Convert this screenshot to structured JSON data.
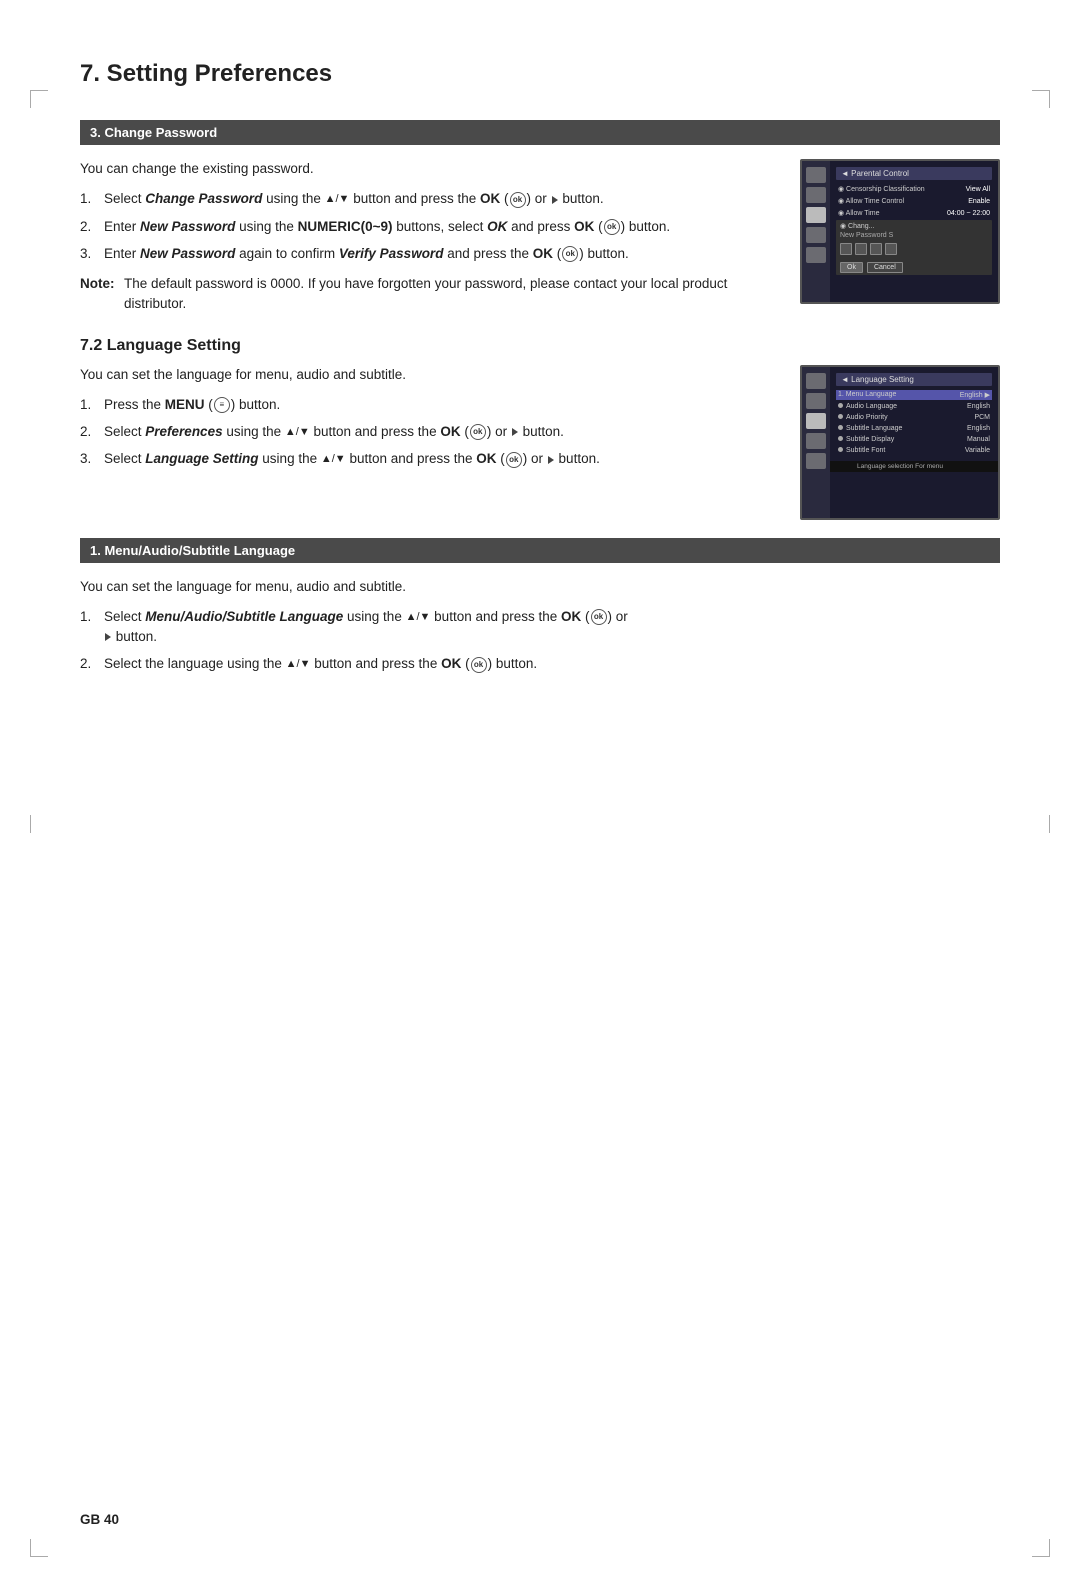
{
  "page": {
    "title": "7. Setting Preferences",
    "footer": "GB 40"
  },
  "section_change_password": {
    "header": "3. Change Password",
    "description": "You can change the existing password.",
    "steps": [
      {
        "num": "1.",
        "text_parts": [
          {
            "type": "text",
            "content": "Select "
          },
          {
            "type": "bold-italic",
            "content": "Change Password"
          },
          {
            "type": "text",
            "content": " using the ▲/▼ button and press the "
          },
          {
            "type": "bold",
            "content": "OK"
          },
          {
            "type": "text",
            "content": " ("
          },
          {
            "type": "ok-symbol",
            "content": "ok"
          },
          {
            "type": "text",
            "content": ") or "
          },
          {
            "type": "arrow",
            "content": "▶"
          },
          {
            "type": "text",
            "content": " button."
          }
        ]
      },
      {
        "num": "2.",
        "text_parts": [
          {
            "type": "text",
            "content": "Enter "
          },
          {
            "type": "bold-italic",
            "content": "New Password"
          },
          {
            "type": "text",
            "content": " using the "
          },
          {
            "type": "bold",
            "content": "NUMERIC(0~9)"
          },
          {
            "type": "text",
            "content": " buttons, select "
          },
          {
            "type": "bold-italic",
            "content": "OK"
          },
          {
            "type": "text",
            "content": " and press "
          },
          {
            "type": "bold",
            "content": "OK"
          },
          {
            "type": "text",
            "content": " ("
          },
          {
            "type": "ok-symbol",
            "content": "ok"
          },
          {
            "type": "text",
            "content": ") button."
          }
        ]
      },
      {
        "num": "3.",
        "text_parts": [
          {
            "type": "text",
            "content": "Enter "
          },
          {
            "type": "bold-italic",
            "content": "New Password"
          },
          {
            "type": "text",
            "content": " again to confirm "
          },
          {
            "type": "bold-italic",
            "content": "Verify Password"
          },
          {
            "type": "text",
            "content": " and press the "
          },
          {
            "type": "bold",
            "content": "OK"
          },
          {
            "type": "text",
            "content": " ("
          },
          {
            "type": "ok-symbol",
            "content": "ok"
          },
          {
            "type": "text",
            "content": ") button."
          }
        ]
      }
    ],
    "note_label": "Note:",
    "note_text": "The default password is 0000. If you have forgotten your password, please contact your local product distributor.",
    "screenshot": {
      "title": "◄ Parental Control",
      "rows": [
        {
          "label": "◉ Censorship Classification",
          "value": "View All"
        },
        {
          "label": "◉ Allow Time Control",
          "value": "Enable"
        },
        {
          "label": "◉ Allow Time",
          "value": "04:00 ~ 22:00"
        },
        {
          "label": "◉ Chang...",
          "value": ""
        }
      ],
      "new_password_label": "New Password S",
      "pw_boxes": 4,
      "buttons": [
        "Ok",
        "Cancel"
      ]
    }
  },
  "section_language_setting": {
    "subtitle": "7.2 Language Setting",
    "description": "You can set the language for menu, audio and subtitle.",
    "steps": [
      {
        "num": "1.",
        "text_before": "Press the ",
        "bold_text": "MENU",
        "text_after": " (   ) button."
      },
      {
        "num": "2.",
        "text_before": "Select ",
        "bold_italic_text": "Preferences",
        "text_after": " using the ▲/▼ button and press the OK (   ) or ▶ button."
      },
      {
        "num": "3.",
        "text_before": "Select ",
        "bold_italic_text": "Language Setting",
        "text_after": " using the ▲/▼ button and press the OK (   ) or ▶ button."
      }
    ],
    "screenshot": {
      "title": "◄ Language Setting",
      "rows": [
        {
          "label": "1. Menu Language",
          "value": "English ▶",
          "highlighted": true
        },
        {
          "label": "◉ Audio Language",
          "value": "English"
        },
        {
          "label": "◉ Audio Priority",
          "value": "PCM"
        },
        {
          "label": "◉ Subtitle Language",
          "value": "English"
        },
        {
          "label": "◉ Subtitle Display",
          "value": "Manual"
        },
        {
          "label": "◉ Subtitle Font",
          "value": "Variable"
        }
      ],
      "caption": "Language selection For menu"
    }
  },
  "section_menu_audio": {
    "header": "1. Menu/Audio/Subtitle Language",
    "description": "You can set the language for menu, audio and subtitle.",
    "steps": [
      {
        "num": "1.",
        "text_before": "Select ",
        "bold_italic_text": "Menu/Audio/Subtitle Language",
        "text_after": " using the ▲/▼ button and press the OK (   ) or",
        "text_after2": "▶ button."
      },
      {
        "num": "2.",
        "text_before": "Select the language using the ▲/▼ button and press the ",
        "bold_text": "OK",
        "text_after": " (   ) button."
      }
    ]
  }
}
